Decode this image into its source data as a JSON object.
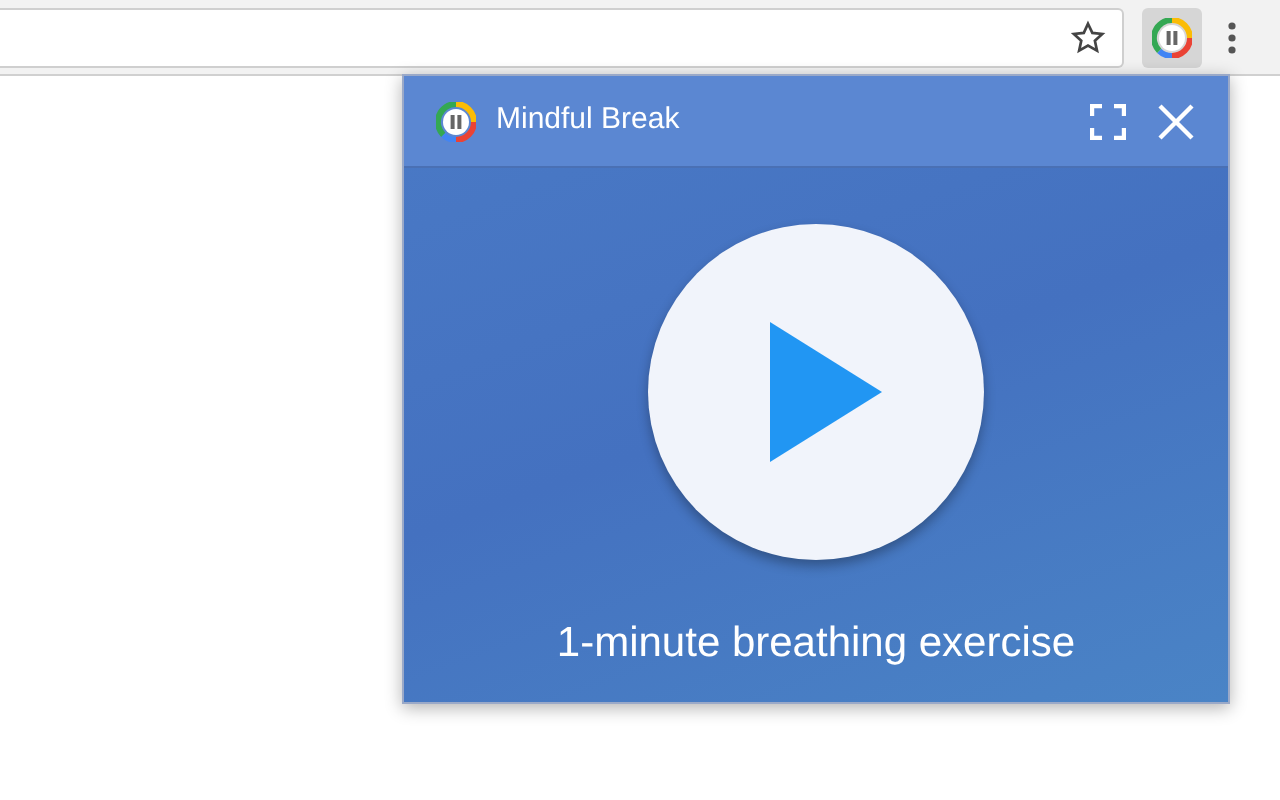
{
  "toolbar": {
    "extension_button": {
      "active": true
    }
  },
  "popup": {
    "title": "Mindful Break",
    "caption": "1-minute breathing exercise"
  }
}
